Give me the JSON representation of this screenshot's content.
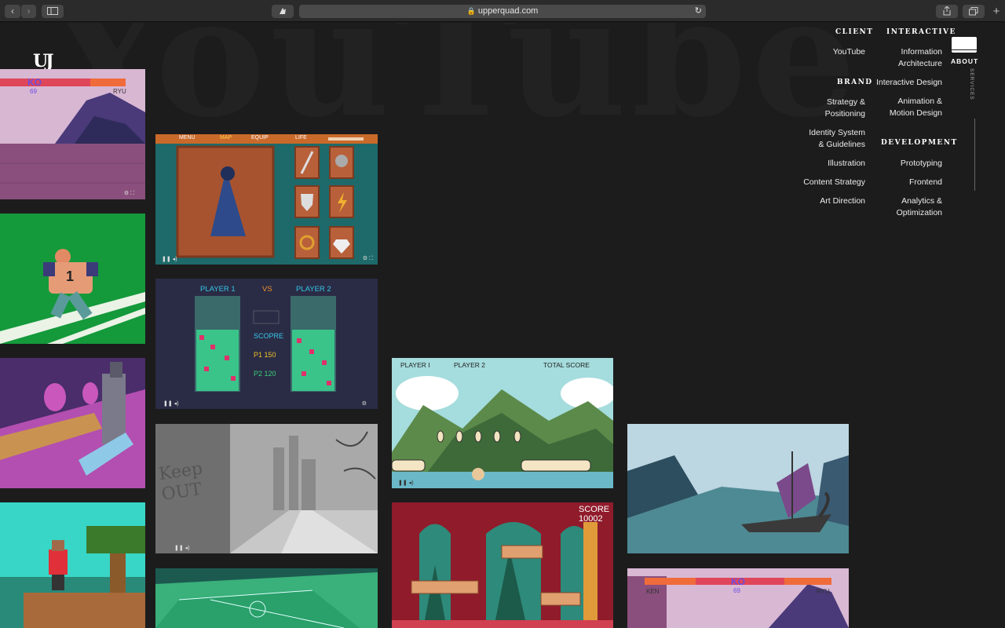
{
  "browser": {
    "url": "upperquad.com",
    "back": "‹",
    "forward": "›",
    "new_tab": "+"
  },
  "logo": "UJ",
  "background_word": "YouTube",
  "tiles": [
    {
      "id": "street-fighter-ko",
      "hud": {
        "left": "KO",
        "sub": "69",
        "right": "RYU"
      }
    },
    {
      "id": "rpg-inventory",
      "hud": {
        "menu": "MENU",
        "map": "MAP",
        "equip": "EQUIP",
        "life": "LIFE"
      }
    },
    {
      "id": "football-runner",
      "jersey": "1"
    },
    {
      "id": "tetris-versus",
      "hud": {
        "p1": "PLAYER 1",
        "vs": "VS",
        "p2": "PLAYER 2",
        "score": "SCOPRE",
        "p1score": "P1 150",
        "p2score": "P2 120"
      }
    },
    {
      "id": "robot-fight"
    },
    {
      "id": "keep-out-city",
      "graffiti": "Keep OUT"
    },
    {
      "id": "platformer-hills",
      "hud": {
        "p1": "PLAYER I",
        "p2": "PLAYER 2",
        "total": "TOTAL SCORE"
      }
    },
    {
      "id": "viking-ship"
    },
    {
      "id": "voxel-character"
    },
    {
      "id": "soccer-field"
    },
    {
      "id": "castle-crates",
      "hud": {
        "score": "SCORE",
        "value": "10002"
      }
    },
    {
      "id": "street-fighter-ken",
      "hud": {
        "left": "KEN",
        "mid": "KO",
        "sub": "69",
        "right": "RYU"
      }
    }
  ],
  "nav": {
    "client": {
      "label": "CLIENT",
      "color": "#b14fe0",
      "items": [
        "YouTube"
      ]
    },
    "brand": {
      "label": "BRAND",
      "color": "#f0e33a",
      "items": [
        "Strategy & Positioning",
        "Identity System & Guidelines",
        "Illustration",
        "Content Strategy",
        "Art Direction"
      ]
    },
    "interactive": {
      "label": "INTERACTIVE",
      "color": "#7de03d",
      "items": [
        "Information Architecture",
        "Interactive Design",
        "Animation & Motion Design"
      ]
    },
    "development": {
      "label": "DEVELOPMENT",
      "color": "#2fd8c0",
      "items": [
        "Prototyping",
        "Frontend",
        "Analytics & Optimization"
      ]
    },
    "about": "ABOUT",
    "services": "SERVICES"
  }
}
